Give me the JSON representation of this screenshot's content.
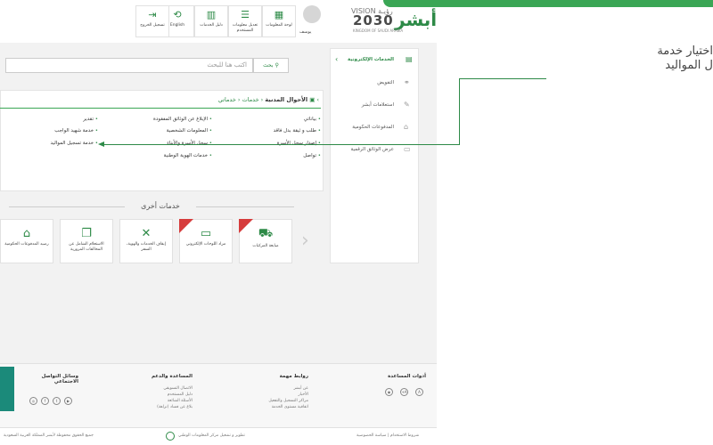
{
  "brand": {
    "vision": "VISION رؤيـة",
    "year": "2030",
    "kingdom": "KINGDOM OF SAUDI ARABIA",
    "logo": "أبشر"
  },
  "header": {
    "user_name": "يوسف",
    "nav": [
      {
        "label": "لوحة المعلومات",
        "icon": "dashboard-icon"
      },
      {
        "label": "تعديل معلومات المستخدم",
        "icon": "edit-user-icon"
      },
      {
        "label": "دليل الخدمات",
        "icon": "book-icon"
      },
      {
        "label": "English",
        "icon": "language-icon"
      },
      {
        "label": "تسجيل الخروج",
        "icon": "logout-icon"
      }
    ]
  },
  "sidebar": {
    "items": [
      {
        "label": "الخدمات الإلكترونية",
        "active": true
      },
      {
        "label": "التفويض"
      },
      {
        "label": "استعلامات أبشر"
      },
      {
        "label": "المدفوعات الحكومية"
      },
      {
        "label": "عرض الوثائق الرقمية"
      }
    ]
  },
  "search": {
    "placeholder": "اكتب هنا للبحث",
    "button": "بحث"
  },
  "breadcrumb": {
    "root": "خدماتي",
    "mid": "خدمات",
    "current": "الأحوال المدنية"
  },
  "services": {
    "col1": [
      "بياناتي",
      "طلب و ثيقة بدل فاقد",
      "إصدار سجل الأسرة",
      "تواصل"
    ],
    "col2": [
      "الإبلاغ عن الوثائق المفقودة",
      "المعلومات الشخصية",
      "سجل الأسرة والأبناء",
      "خدمات الهوية الوطنية"
    ],
    "col3": [
      "تقدير",
      "خدمة شهيد الواجب",
      "خدمة تسجيل المواليد"
    ]
  },
  "other_services": {
    "title": "خدمات أخرى",
    "cards": [
      {
        "label": "مبايعة المركبات",
        "icon": "car-icon",
        "ribbon": true
      },
      {
        "label": "مزاد اللوحات الإلكتروني",
        "icon": "plate-icon",
        "ribbon": true
      },
      {
        "label": "إيقاف الخدمات والهوية، السفر",
        "icon": "stop-icon"
      },
      {
        "label": "الاستعلام الشامل عن المخالفات المرورية",
        "icon": "traffic-icon"
      },
      {
        "label": "رصيد المدفوعات الحكومية",
        "icon": "wallet-icon"
      }
    ]
  },
  "footer": {
    "tools": "أدوات المساعدة",
    "links_title": "روابط مهمة",
    "links": [
      "عن أبشر",
      "الأخبار",
      "مراكز التسجيل والتفعيل",
      "اتفاقية مستوى الخدمة"
    ],
    "support_title": "المساعدة والدعم",
    "support": [
      "الاتصال التسويقي",
      "دليل المستخدم",
      "الأسئلة الشائعة",
      "بلاغ عن فساد (نزاهة)"
    ],
    "social_title": "وسائل التواصل الاجتماعي"
  },
  "bottom": {
    "terms": "شروط الاستخدام | سياسة الخصوصية",
    "dev": "تطوير و تشغيل مركز المعلومات الوطني",
    "copy": "جميع الحقوق محفوظة لأبشر المملكة العربية السعودية"
  },
  "callout": {
    "line1": "اختيار خدمة",
    "line2": "ل المواليد"
  },
  "colors": {
    "accent": "#2d8a47",
    "ribbon": "#d63c3c"
  }
}
